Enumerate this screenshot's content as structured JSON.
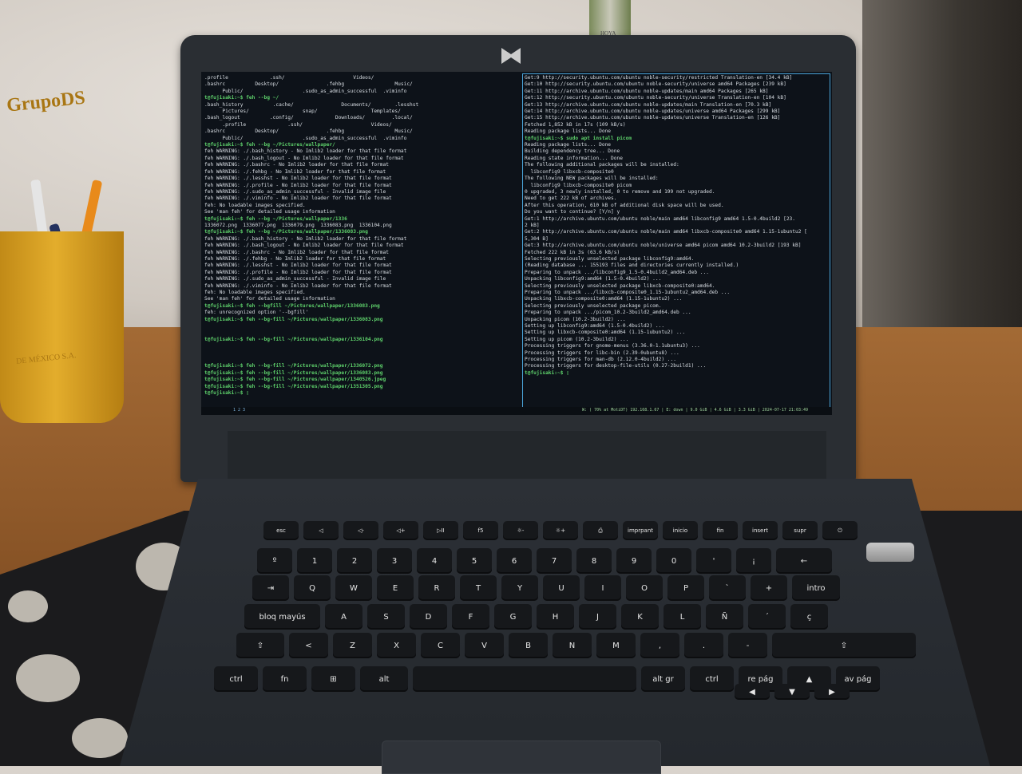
{
  "mug": {
    "text": "GrupoDS",
    "subtext": "DE MÉXICO S.A."
  },
  "bottle": {
    "label": "HOYA"
  },
  "terminal_left": {
    "lines": [
      {
        "t": ".profile              .ssh/                       Videos/        ",
        "p": false
      },
      {
        "t": ".bashrc          Desktop/                .fehbg                 Music/",
        "p": false
      },
      {
        "t": "      Public/                    .sudo_as_admin_successful  .viminfo",
        "p": false
      },
      {
        "t": "t@fujisaki:~$ feh --bg ~/",
        "p": true
      },
      {
        "t": ".bash_history          .cache/                Documents/        .lesshst",
        "p": false
      },
      {
        "t": "      Pictures/                  snap/                  Templates/",
        "p": false
      },
      {
        "t": ".bash_logout          .config/              Downloads/         .local/",
        "p": false
      },
      {
        "t": "      .profile              .ssh/                       Videos/",
        "p": false
      },
      {
        "t": ".bashrc          Desktop/                .fehbg                 Music/",
        "p": false
      },
      {
        "t": "      Public/                    .sudo_as_admin_successful  .viminfo",
        "p": false
      },
      {
        "t": "t@fujisaki:~$ feh --bg ~/Pictures/wallpaper/",
        "p": true
      },
      {
        "t": "feh WARNING: ./.bash_history - No Imlib2 loader for that file format",
        "p": false
      },
      {
        "t": "feh WARNING: ./.bash_logout - No Imlib2 loader for that file format",
        "p": false
      },
      {
        "t": "feh WARNING: ./.bashrc - No Imlib2 loader for that file format",
        "p": false
      },
      {
        "t": "feh WARNING: ./.fehbg - No Imlib2 loader for that file format",
        "p": false
      },
      {
        "t": "feh WARNING: ./.lesshst - No Imlib2 loader for that file format",
        "p": false
      },
      {
        "t": "feh WARNING: ./.profile - No Imlib2 loader for that file format",
        "p": false
      },
      {
        "t": "feh WARNING: ./.sudo_as_admin_successful - Invalid image file",
        "p": false
      },
      {
        "t": "feh WARNING: ./.viminfo - No Imlib2 loader for that file format",
        "p": false
      },
      {
        "t": "feh: No loadable images specified.",
        "p": false
      },
      {
        "t": "See 'man feh' for detailed usage information",
        "p": false
      },
      {
        "t": "t@fujisaki:~$ feh --bg ~/Pictures/wallpaper/1336",
        "p": true
      },
      {
        "t": "1336072.png  1336077.png  1336079.png  1336083.png  1336104.png",
        "p": false
      },
      {
        "t": "t@fujisaki:~$ feh --bg ~/Pictures/wallpaper/1336083.png",
        "p": true
      },
      {
        "t": "feh WARNING: ./.bash_history - No Imlib2 loader for that file format",
        "p": false
      },
      {
        "t": "feh WARNING: ./.bash_logout - No Imlib2 loader for that file format",
        "p": false
      },
      {
        "t": "feh WARNING: ./.bashrc - No Imlib2 loader for that file format",
        "p": false
      },
      {
        "t": "feh WARNING: ./.fehbg - No Imlib2 loader for that file format",
        "p": false
      },
      {
        "t": "feh WARNING: ./.lesshst - No Imlib2 loader for that file format",
        "p": false
      },
      {
        "t": "feh WARNING: ./.profile - No Imlib2 loader for that file format",
        "p": false
      },
      {
        "t": "feh WARNING: ./.sudo_as_admin_successful - Invalid image file",
        "p": false
      },
      {
        "t": "feh WARNING: ./.viminfo - No Imlib2 loader for that file format",
        "p": false
      },
      {
        "t": "feh: No loadable images specified.",
        "p": false
      },
      {
        "t": "See 'man feh' for detailed usage information",
        "p": false
      },
      {
        "t": "t@fujisaki:~$ feh --bgfill ~/Pictures/wallpaper/1336083.png",
        "p": true
      },
      {
        "t": "feh: unrecognized option '--bgfill'",
        "p": false
      },
      {
        "t": "t@fujisaki:~$ feh --bg-fill ~/Pictures/wallpaper/1336083.png",
        "p": true
      },
      {
        "t": "",
        "p": false
      },
      {
        "t": "",
        "p": false
      },
      {
        "t": "t@fujisaki:~$ feh --bg-fill ~/Pictures/wallpaper/1336104.png",
        "p": true
      },
      {
        "t": "",
        "p": false
      },
      {
        "t": "",
        "p": false
      },
      {
        "t": "",
        "p": false
      },
      {
        "t": "t@fujisaki:~$ feh --bg-fill ~/Pictures/wallpaper/1336072.png",
        "p": true
      },
      {
        "t": "t@fujisaki:~$ feh --bg-fill ~/Pictures/wallpaper/1336083.png",
        "p": true
      },
      {
        "t": "t@fujisaki:~$ feh --bg-fill ~/Pictures/wallpaper/1340526.jpeg",
        "p": true
      },
      {
        "t": "t@fujisaki:~$ feh --bg-fill ~/Pictures/wallpaper/1351305.png",
        "p": true
      },
      {
        "t": "t@fujisaki:~$ ▯",
        "p": true
      }
    ]
  },
  "terminal_right": {
    "lines": [
      {
        "t": "Get:9 http://security.ubuntu.com/ubuntu noble-security/restricted Translation-en [34.4 kB]",
        "p": false
      },
      {
        "t": "Get:10 http://security.ubuntu.com/ubuntu noble-security/universe amd64 Packages [239 kB]",
        "p": false
      },
      {
        "t": "Get:11 http://archive.ubuntu.com/ubuntu noble-updates/main amd64 Packages [265 kB]",
        "p": false
      },
      {
        "t": "Get:12 http://security.ubuntu.com/ubuntu noble-security/universe Translation-en [104 kB]",
        "p": false
      },
      {
        "t": "Get:13 http://archive.ubuntu.com/ubuntu noble-updates/main Translation-en [70.3 kB]",
        "p": false
      },
      {
        "t": "Get:14 http://archive.ubuntu.com/ubuntu noble-updates/universe amd64 Packages [299 kB]",
        "p": false
      },
      {
        "t": "Get:15 http://archive.ubuntu.com/ubuntu noble-updates/universe Translation-en [126 kB]",
        "p": false
      },
      {
        "t": "Fetched 1,852 kB in 17s (109 kB/s)",
        "p": false
      },
      {
        "t": "Reading package lists... Done",
        "p": false
      },
      {
        "t": "t@fujisaki:~$ sudo apt install picom",
        "p": true
      },
      {
        "t": "Reading package lists... Done",
        "p": false
      },
      {
        "t": "Building dependency tree... Done",
        "p": false
      },
      {
        "t": "Reading state information... Done",
        "p": false
      },
      {
        "t": "The following additional packages will be installed:",
        "p": false
      },
      {
        "t": "  libconfig9 libxcb-composite0",
        "p": false
      },
      {
        "t": "The following NEW packages will be installed:",
        "p": false
      },
      {
        "t": "  libconfig9 libxcb-composite0 picom",
        "p": false
      },
      {
        "t": "0 upgraded, 3 newly installed, 0 to remove and 199 not upgraded.",
        "p": false
      },
      {
        "t": "Need to get 222 kB of archives.",
        "p": false
      },
      {
        "t": "After this operation, 610 kB of additional disk space will be used.",
        "p": false
      },
      {
        "t": "Do you want to continue? [Y/n] y",
        "p": false
      },
      {
        "t": "Get:1 http://archive.ubuntu.com/ubuntu noble/main amd64 libconfig9 amd64 1.5-0.4build2 [23.",
        "p": false
      },
      {
        "t": "2 kB]",
        "p": false
      },
      {
        "t": "Get:2 http://archive.ubuntu.com/ubuntu noble/main amd64 libxcb-composite0 amd64 1.15-1ubuntu2 [",
        "p": false
      },
      {
        "t": "5,304 B]",
        "p": false
      },
      {
        "t": "Get:3 http://archive.ubuntu.com/ubuntu noble/universe amd64 picom amd64 10.2-3build2 [193 kB]",
        "p": false
      },
      {
        "t": "Fetched 222 kB in 3s (63.6 kB/s)",
        "p": false
      },
      {
        "t": "Selecting previously unselected package libconfig9:amd64.",
        "p": false
      },
      {
        "t": "(Reading database ... 155193 files and directories currently installed.)",
        "p": false
      },
      {
        "t": "Preparing to unpack .../libconfig9_1.5-0.4build2_amd64.deb ...",
        "p": false
      },
      {
        "t": "Unpacking libconfig9:amd64 (1.5-0.4build2) ...",
        "p": false
      },
      {
        "t": "Selecting previously unselected package libxcb-composite0:amd64.",
        "p": false
      },
      {
        "t": "Preparing to unpack .../libxcb-composite0_1.15-1ubuntu2_amd64.deb ...",
        "p": false
      },
      {
        "t": "Unpacking libxcb-composite0:amd64 (1.15-1ubuntu2) ...",
        "p": false
      },
      {
        "t": "Selecting previously unselected package picom.",
        "p": false
      },
      {
        "t": "Preparing to unpack .../picom_10.2-3build2_amd64.deb ...",
        "p": false
      },
      {
        "t": "Unpacking picom (10.2-3build2) ...",
        "p": false
      },
      {
        "t": "Setting up libconfig9:amd64 (1.5-0.4build2) ...",
        "p": false
      },
      {
        "t": "Setting up libxcb-composite0:amd64 (1.15-1ubuntu2) ...",
        "p": false
      },
      {
        "t": "Setting up picom (10.2-3build2) ...",
        "p": false
      },
      {
        "t": "Processing triggers for gnome-menus (3.36.0-1.1ubuntu3) ...",
        "p": false
      },
      {
        "t": "Processing triggers for libc-bin (2.39-0ubuntu8) ...",
        "p": false
      },
      {
        "t": "Processing triggers for man-db (2.12.0-4build2) ...",
        "p": false
      },
      {
        "t": "Processing triggers for desktop-file-utils (0.27-2build1) ...",
        "p": false
      },
      {
        "t": "t@fujisaki:~$ ▯",
        "p": true
      }
    ]
  },
  "workspaces": "1  2  3",
  "statusbar": "W: ( 70% at MotiDT) 192.168.1.67 | E: down | 9.0 GiB | 4.6 GiB | 3.3 GiB | 2024-07-17 21:03:49",
  "keyboard": {
    "rows": [
      [
        "esc",
        "◁",
        "◁-",
        "◁+",
        "▷II",
        "f5",
        "☼-",
        "☼+",
        "⎙",
        "imprpant",
        "inicio",
        "fin",
        "insert",
        "supr",
        "⏻"
      ],
      [
        "º",
        "1",
        "2",
        "3",
        "4",
        "5",
        "6",
        "7",
        "8",
        "9",
        "0",
        "'",
        "¡",
        "←"
      ],
      [
        "⇥",
        "Q",
        "W",
        "E",
        "R",
        "T",
        "Y",
        "U",
        "I",
        "O",
        "P",
        "`",
        "+",
        "intro"
      ],
      [
        "bloq mayús",
        "A",
        "S",
        "D",
        "F",
        "G",
        "H",
        "J",
        "K",
        "L",
        "Ñ",
        "´",
        "ç"
      ],
      [
        "⇧",
        "<",
        "Z",
        "X",
        "C",
        "V",
        "B",
        "N",
        "M",
        ",",
        ".",
        "-",
        "⇧"
      ],
      [
        "ctrl",
        "fn",
        "⊞",
        "alt",
        "",
        "alt gr",
        "ctrl",
        "re pág",
        "▲",
        "av pág"
      ],
      [
        "◀",
        "▼",
        "▶"
      ]
    ]
  }
}
